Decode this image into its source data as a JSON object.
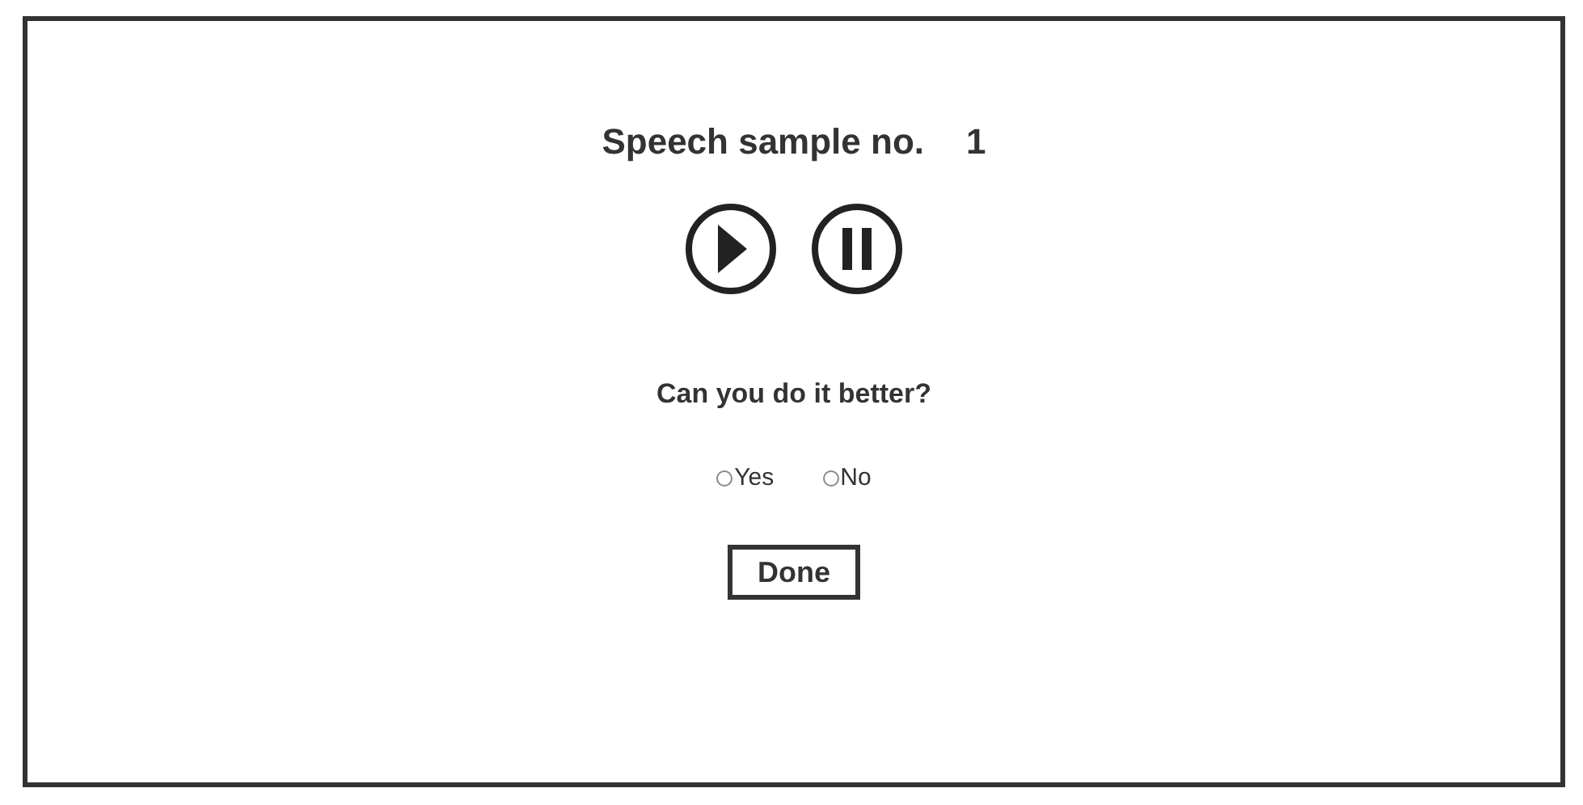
{
  "title": {
    "label": "Speech sample no.",
    "number": "1"
  },
  "controls": [
    {
      "kind": "play"
    },
    {
      "kind": "pause"
    }
  ],
  "question": "Can you do it better?",
  "options": [
    {
      "label": "Yes",
      "selected": false
    },
    {
      "label": "No",
      "selected": false
    }
  ],
  "button": "Done"
}
